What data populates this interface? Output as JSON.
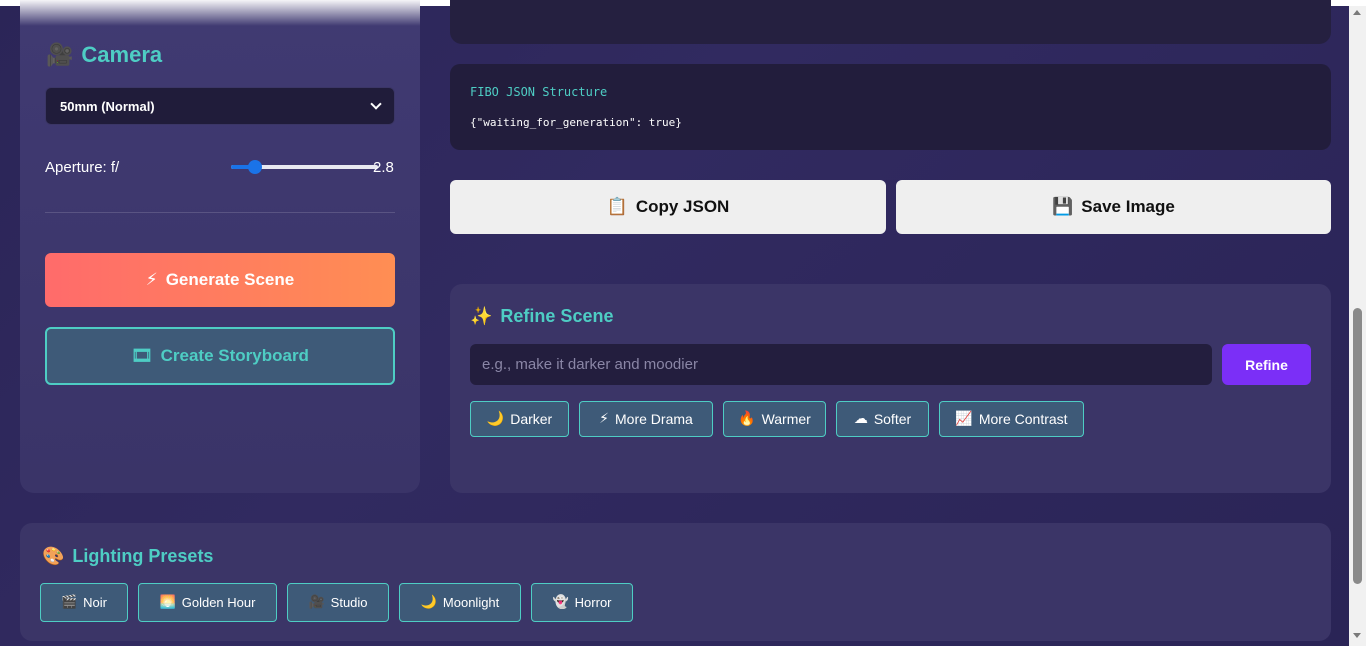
{
  "camera": {
    "title": "Camera",
    "icon": "movie-camera-icon",
    "icon_glyph": "🎥",
    "lens_selected": "50mm (Normal)",
    "aperture_label": "Aperture: f/",
    "aperture_value": "2.8",
    "aperture_fraction": 0.13
  },
  "actions": {
    "generate_icon": "⚡",
    "generate_label": "Generate Scene",
    "storyboard_icon": "🎞",
    "storyboard_label": "Create Storyboard"
  },
  "json_panel": {
    "title": "FIBO JSON Structure",
    "body": "{\"waiting_for_generation\": true}"
  },
  "output_buttons": {
    "copy_icon": "📋",
    "copy_label": "Copy JSON",
    "save_icon": "💾",
    "save_label": "Save Image"
  },
  "refine": {
    "icon": "✨",
    "title": "Refine Scene",
    "placeholder": "e.g., make it darker and moodier",
    "button_label": "Refine",
    "chips": [
      {
        "icon": "🌙",
        "label": "Darker"
      },
      {
        "icon": "⚡",
        "label": "More Drama"
      },
      {
        "icon": "🔥",
        "label": "Warmer"
      },
      {
        "icon": "☁",
        "label": "Softer"
      },
      {
        "icon": "📈",
        "label": "More Contrast"
      }
    ]
  },
  "lighting": {
    "icon": "🎨",
    "title": "Lighting Presets",
    "presets": [
      {
        "icon": "🎬",
        "label": "Noir"
      },
      {
        "icon": "🌅",
        "label": "Golden Hour"
      },
      {
        "icon": "🎥",
        "label": "Studio"
      },
      {
        "icon": "🌙",
        "label": "Moonlight"
      },
      {
        "icon": "👻",
        "label": "Horror"
      }
    ]
  },
  "colors": {
    "accent_teal": "#4ecdc4",
    "generate_gradient_start": "#ff6b6b",
    "generate_gradient_end": "#ff8e53",
    "refine_purple": "#7b2ff7"
  }
}
